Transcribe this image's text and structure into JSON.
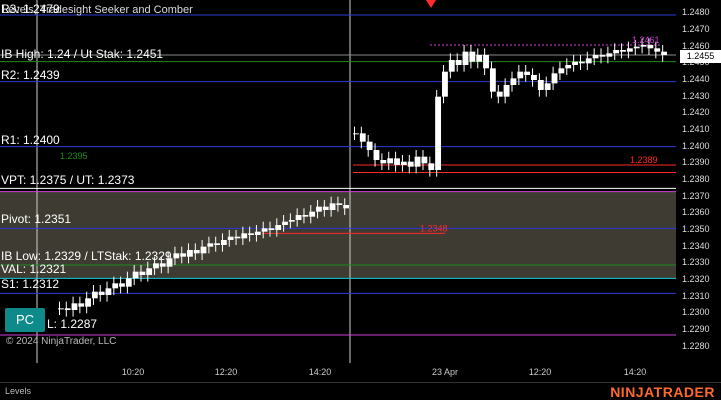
{
  "header": {
    "title": "Levels, Tradesight Seeker and Comber"
  },
  "colors": {
    "background": "#000000",
    "candle": "#ffffff",
    "level_line": "#2b3bd6",
    "value_area": "#b0a890",
    "seeker": "#1f8a1f",
    "comber": "#19c7d8",
    "accent_red": "#ff2a2a",
    "magenta": "#d13fd8",
    "brand": "#ff6a2a",
    "pc_button": "#0e8a8a"
  },
  "levels": [
    {
      "text": "R3: 1.2479"
    },
    {
      "text": "IB High: 1.24 / Ut Stak: 1.2451"
    },
    {
      "text": "R2: 1.2439"
    },
    {
      "text": "R1: 1.2400"
    },
    {
      "text": "VPT: 1.2375 / UT: 1.2373"
    },
    {
      "text": "Pivot: 1.2351"
    },
    {
      "text": "IB Low: 1.2329 / LTStak: 1.2329"
    },
    {
      "text": "VAL: 1.2321"
    },
    {
      "text": "S1: 1.2312"
    },
    {
      "text": "L: 1.2287"
    }
  ],
  "inline_values": {
    "seeker_1": "1.2395",
    "red_level_1": "1.2389",
    "red_level_2": "1.2348",
    "magenta_level": "1.2461"
  },
  "buttons": {
    "pc": "PC"
  },
  "footer": {
    "copyright": "© 2024 NinjaTrader, LLC",
    "tab": "Levels",
    "brand": "NINJATRADER"
  },
  "chart_data": {
    "type": "candlestick",
    "instrument": "",
    "y_axis": {
      "ticks": [
        "1.2480",
        "1.2470",
        "1.2460",
        "1.2450",
        "1.2440",
        "1.2430",
        "1.2420",
        "1.2410",
        "1.2400",
        "1.2390",
        "1.2380",
        "1.2370",
        "1.2360",
        "1.2350",
        "1.2340",
        "1.2330",
        "1.2320",
        "1.2310",
        "1.2300",
        "1.2290",
        "1.2280"
      ],
      "ylim": [
        1.2275,
        1.2485
      ]
    },
    "x_axis": {
      "ticks": [
        "10:20",
        "12:20",
        "14:20",
        "23 Apr",
        "12:20",
        "14:20"
      ]
    },
    "last_price": "1.2455",
    "grid": false,
    "levels": [
      {
        "name": "R3",
        "value": 1.2479
      },
      {
        "name": "IB High",
        "value": 1.2455
      },
      {
        "name": "Ut Stak",
        "value": 1.2451
      },
      {
        "name": "R2",
        "value": 1.2439
      },
      {
        "name": "R1",
        "value": 1.24
      },
      {
        "name": "VPT",
        "value": 1.2375
      },
      {
        "name": "UT",
        "value": 1.2373
      },
      {
        "name": "Pivot",
        "value": 1.2351
      },
      {
        "name": "IB Low",
        "value": 1.2329
      },
      {
        "name": "LTStak",
        "value": 1.2329
      },
      {
        "name": "VAL",
        "value": 1.2321
      },
      {
        "name": "S1",
        "value": 1.2312
      },
      {
        "name": "L",
        "value": 1.2287
      }
    ],
    "value_area": {
      "high": 1.2373,
      "low": 1.2321
    },
    "session1_closes": [
      1.2303,
      1.2302,
      1.2306,
      1.2304,
      1.2309,
      1.2313,
      1.2311,
      1.2315,
      1.2318,
      1.2316,
      1.2321,
      1.2325,
      1.2323,
      1.2327,
      1.233,
      1.2328,
      1.2333,
      1.2336,
      1.2334,
      1.2338,
      1.2336,
      1.234,
      1.2342,
      1.2341,
      1.2344,
      1.2346,
      1.2345,
      1.2348,
      1.2347,
      1.2349,
      1.2351,
      1.235,
      1.2353,
      1.2355,
      1.2356,
      1.2359,
      1.2358,
      1.2361,
      1.2364,
      1.2362,
      1.2366,
      1.2365,
      1.2363
    ],
    "session2_closes": [
      1.2408,
      1.2403,
      1.2398,
      1.2392,
      1.239,
      1.2393,
      1.2389,
      1.2391,
      1.2388,
      1.2394,
      1.239,
      1.2386,
      1.243,
      1.2445,
      1.2452,
      1.2449,
      1.2457,
      1.2451,
      1.2455,
      1.2447,
      1.2433,
      1.243,
      1.2437,
      1.2441,
      1.2445,
      1.2443,
      1.244,
      1.2434,
      1.2438,
      1.2444,
      1.2447,
      1.2449,
      1.2451,
      1.245,
      1.2453,
      1.2455,
      1.2454,
      1.2456,
      1.2458,
      1.2457,
      1.2459,
      1.246,
      1.2461,
      1.2459,
      1.2457,
      1.2455
    ]
  }
}
